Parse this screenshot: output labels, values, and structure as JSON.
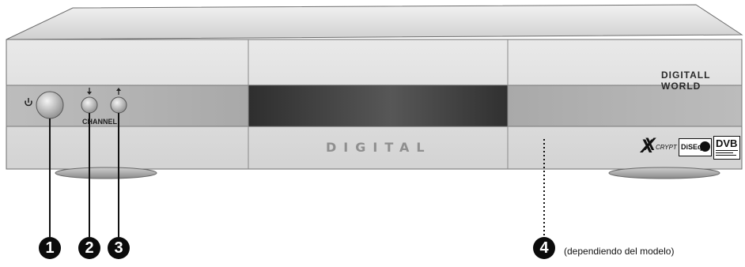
{
  "panel": {
    "brand_text": "DIGITALL WORLD",
    "display_text": "DIGITAL",
    "channel_label": "CHANNEL",
    "logos": {
      "xcrypt": "XCRYPT",
      "diseqc": "DiSEqC",
      "dvb": "DVB"
    }
  },
  "icons": {
    "power": "power-icon",
    "channel_down": "arrow-down-icon",
    "channel_up": "arrow-up-icon"
  },
  "callouts": [
    {
      "number": "1"
    },
    {
      "number": "2"
    },
    {
      "number": "3"
    },
    {
      "number": "4"
    }
  ],
  "callout_note": "(dependiendo del modelo)",
  "colors": {
    "body_light": "#dcdcdc",
    "band_dark": "#9a9a9a",
    "display_dark": "#3c3c3c",
    "callout_fill": "#0b0b0b"
  }
}
